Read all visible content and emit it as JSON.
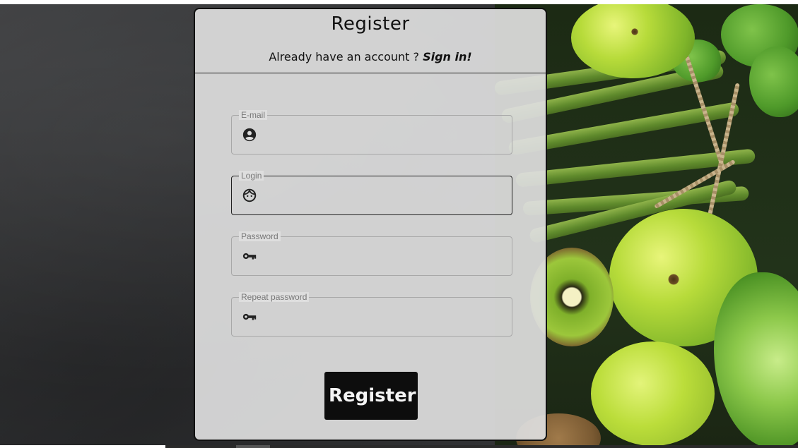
{
  "form": {
    "title": "Register",
    "signin_prompt": "Already have an account ?",
    "signin_link": "Sign in!",
    "fields": [
      {
        "label": "E-mail",
        "value": "",
        "icon": "account-circle-icon"
      },
      {
        "label": "Login",
        "value": "",
        "icon": "face-icon"
      },
      {
        "label": "Password",
        "value": "",
        "icon": "key-icon"
      },
      {
        "label": "Repeat password",
        "value": "",
        "icon": "key-icon"
      }
    ],
    "submit_label": "Register"
  },
  "colors": {
    "panel_bg": "#dedede",
    "button_bg": "#0d0d0d",
    "button_text": "#f4f4f4",
    "field_border": "#a8a8a8",
    "field_border_active": "#222222",
    "label_text": "#777777"
  }
}
